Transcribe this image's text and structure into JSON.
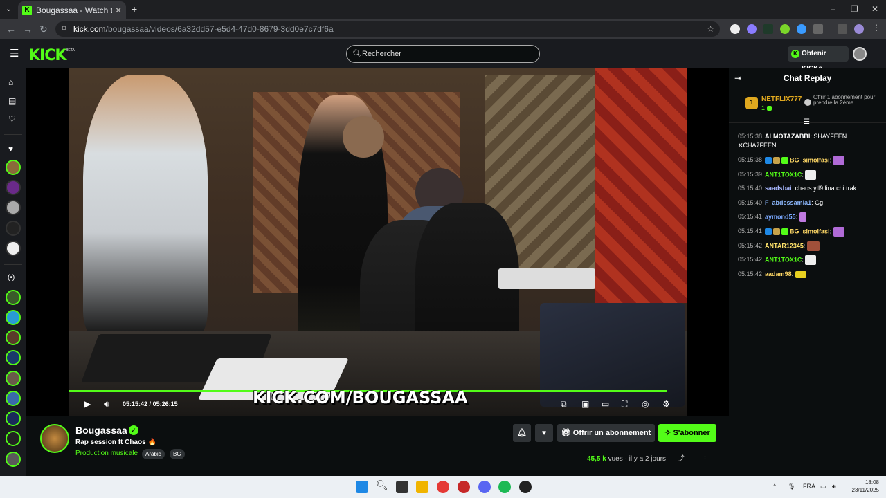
{
  "browser": {
    "tab_title": "Bougassaa - Watch the VOD",
    "url_host": "kick.com",
    "url_path": "/bougassaa/videos/6a32dd57-e5d4-47d0-8679-3dd0e7c7df6a"
  },
  "header": {
    "logo": "KICK",
    "beta": "BETA",
    "search_placeholder": "Rechercher",
    "kicks_button": "Obtenir KICKs"
  },
  "video": {
    "banner": "KICK.COM/BOUGASSAA",
    "current_time": "05:15:42",
    "separator": "/",
    "duration": "05:26:15",
    "progress_fraction": 0.968
  },
  "chat": {
    "title": "Chat Replay",
    "pinned": {
      "rank": "1",
      "user": "NETFLIX777",
      "count": "1",
      "offer": "Offrir 1 abonnement pour prendre la 2ème"
    },
    "messages": [
      {
        "ts": "05:15:38",
        "user": "ALMOTAZABBI",
        "color": "#f0e68c",
        "text": "SHAYFEEN ✕CHA7FEEN"
      },
      {
        "ts": "05:15:38",
        "user": "BG_simolfasi",
        "color": "#ffd866",
        "text": ""
      },
      {
        "ts": "05:15:39",
        "user": "ANT1TOX1C",
        "color": "#53fc18",
        "text": ""
      },
      {
        "ts": "05:15:40",
        "user": "saadsbai",
        "color": "#a8b8ff",
        "text": "chaos ytl9 lina chi trak"
      },
      {
        "ts": "05:15:40",
        "user": "F_abdessamia1",
        "color": "#8ab4f8",
        "text": "Gg"
      },
      {
        "ts": "05:15:41",
        "user": "aymond55",
        "color": "#7aa8ff",
        "text": ""
      },
      {
        "ts": "05:15:41",
        "user": "BG_simolfasi",
        "color": "#ffd866",
        "text": ""
      },
      {
        "ts": "05:15:42",
        "user": "ANTAR12345",
        "color": "#ffe36b",
        "text": ""
      },
      {
        "ts": "05:15:42",
        "user": "ANT1TOX1C",
        "color": "#53fc18",
        "text": ""
      },
      {
        "ts": "05:15:42",
        "user": "aadam98",
        "color": "#ffd866",
        "text": ""
      }
    ]
  },
  "info": {
    "streamer": "Bougassaa",
    "title": "Rap session ft Chaos 🔥",
    "category": "Production musicale",
    "tags": [
      "Arabic",
      "BG"
    ],
    "gift_button": "Offrir un abonnement",
    "subscribe_button": "S'abonner",
    "views": "45,5 k",
    "views_label": "vues",
    "ago": "il y a 2 jours"
  },
  "taskbar": {
    "lang": "FRA",
    "time": "18:08",
    "date": "23/11/2025"
  },
  "colors": {
    "accent": "#53fc18",
    "bg": "#0b0e0f",
    "panel": "#191b1f"
  }
}
